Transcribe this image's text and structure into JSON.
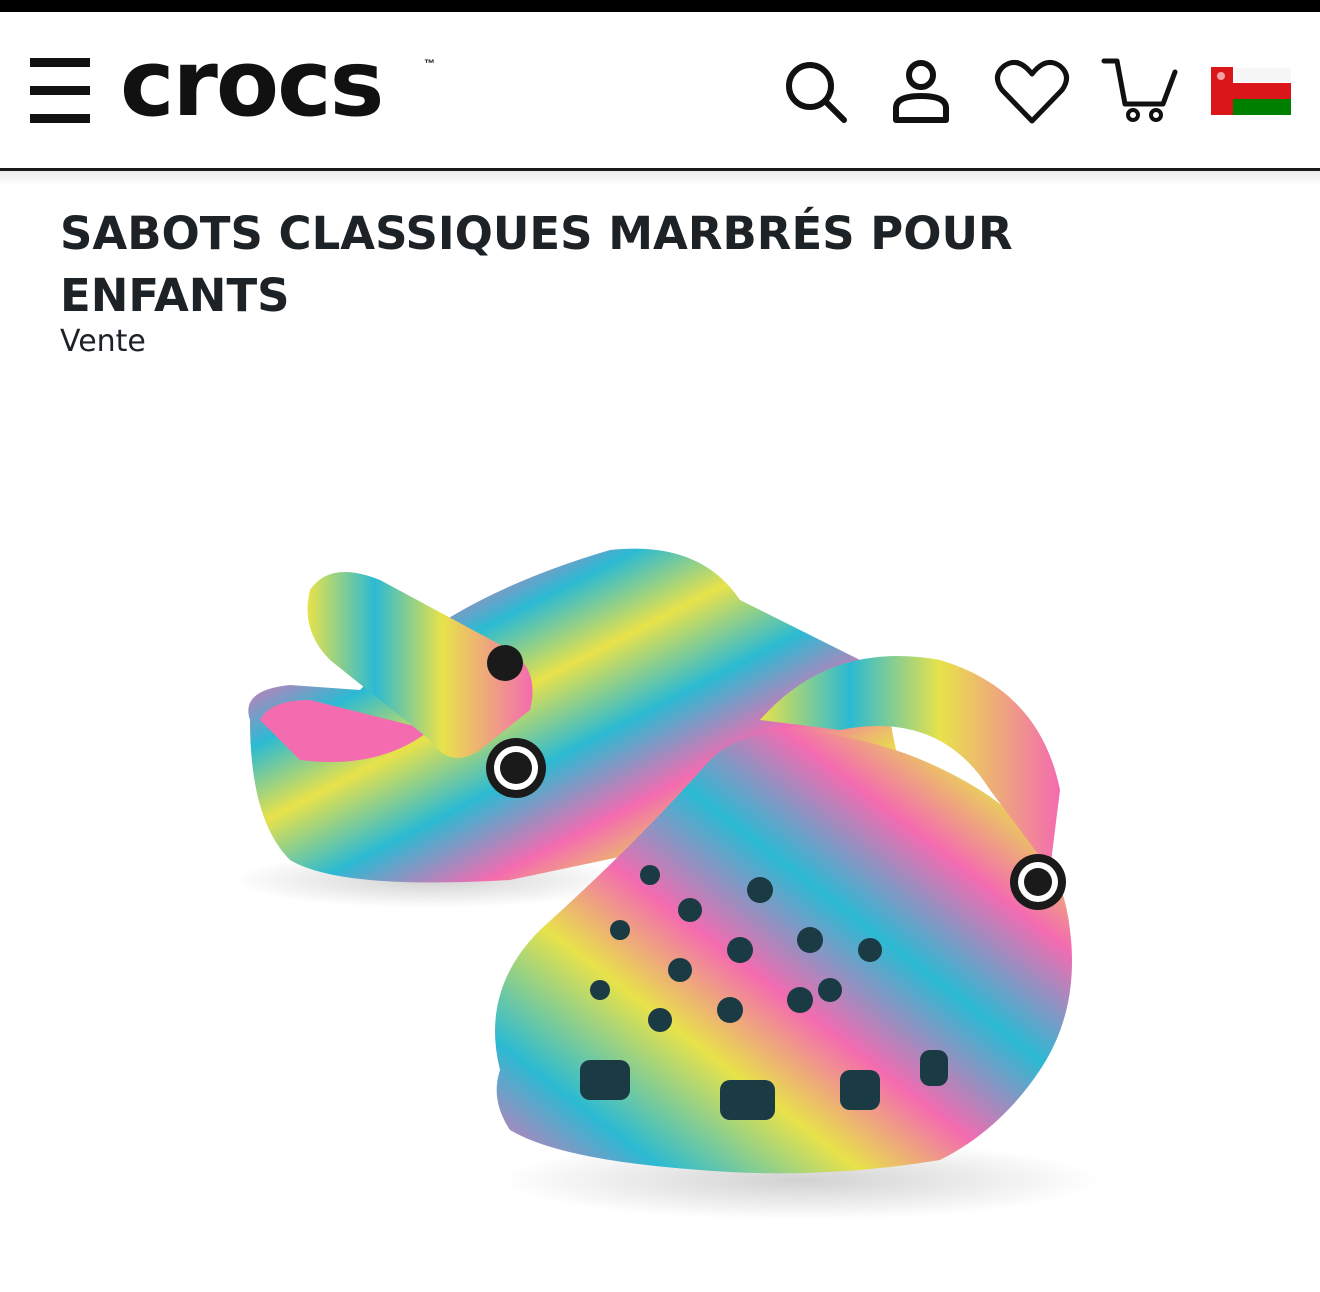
{
  "header": {
    "logo_text": "crocs",
    "logo_tm": "™",
    "icons": [
      "menu-icon",
      "search-icon",
      "account-icon",
      "heart-icon",
      "cart-icon",
      "oman-flag-icon"
    ]
  },
  "product": {
    "title": "SABOTS CLASSIQUES MARBRÉS POUR ENFANTS",
    "subtitle": "Vente",
    "image_alt": "marbled kids classic clog, turquoise pink yellow"
  },
  "colors": {
    "text": "#1d2226",
    "turquoise": "#2bbad3",
    "pink": "#f46bb0",
    "yellow": "#e8e24a",
    "flag_red": "#db161b",
    "flag_green": "#008000"
  }
}
